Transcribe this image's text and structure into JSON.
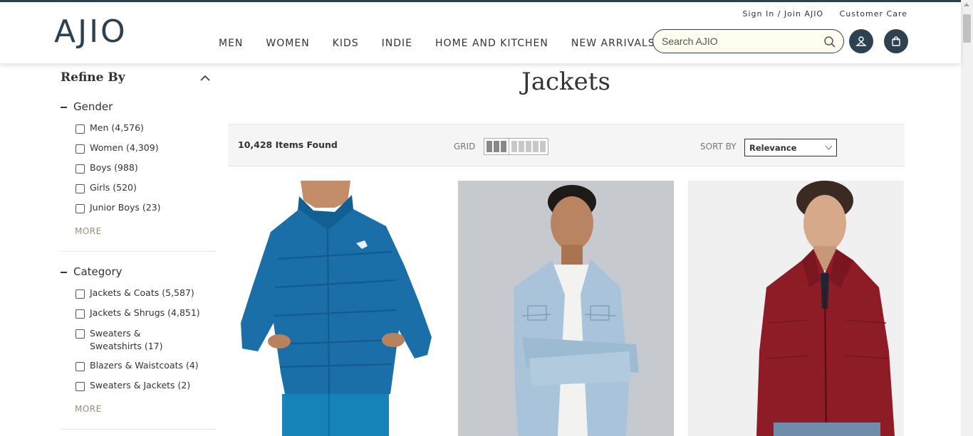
{
  "header": {
    "logo": "AJIO",
    "sign_in": "Sign In / Join AJIO",
    "customer_care": "Customer Care",
    "nav": [
      "MEN",
      "WOMEN",
      "KIDS",
      "INDIE",
      "HOME AND KITCHEN",
      "NEW ARRIVALS"
    ],
    "search_placeholder": "Search AJIO"
  },
  "sidebar": {
    "title": "Refine By",
    "sections": [
      {
        "title": "Gender",
        "options": [
          "Men (4,576)",
          "Women (4,309)",
          "Boys (988)",
          "Girls (520)",
          "Junior Boys (23)"
        ],
        "more": "MORE"
      },
      {
        "title": "Category",
        "options": [
          "Jackets & Coats (5,587)",
          "Jackets & Shrugs (4,851)",
          "Sweaters & Sweatshirts (17)",
          "Blazers & Waistcoats (4)",
          "Sweaters & Jackets (2)"
        ],
        "more": "MORE"
      }
    ]
  },
  "main": {
    "title": "Jackets",
    "items_found": "10,428 Items Found",
    "grid_label": "GRID",
    "sort_label": "SORT BY",
    "sort_value": "Relevance"
  },
  "colors": {
    "brand": "#2c4152",
    "more_link": "#a08a72",
    "product_1": "#1a6fa8",
    "product_2": "#a9c4da",
    "product_3": "#8e1c27"
  },
  "icons": [
    "search-icon",
    "user-icon",
    "bag-icon",
    "chevron-up-icon",
    "chevron-down-icon"
  ]
}
